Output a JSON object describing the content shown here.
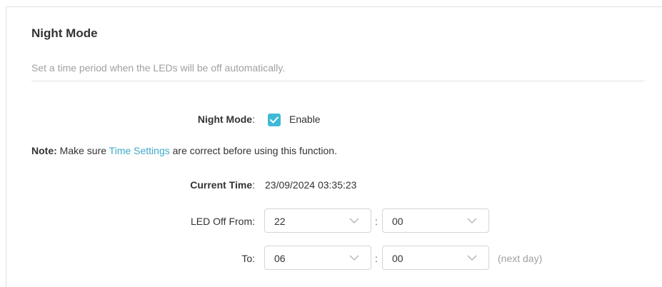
{
  "section": {
    "title": "Night Mode",
    "description": "Set a time period when the LEDs will be off automatically."
  },
  "night_mode": {
    "label": "Night Mode",
    "colon": ":",
    "checkbox_checked": true,
    "enable_label": "Enable"
  },
  "note": {
    "prefix": "Note:",
    "before": " Make sure ",
    "link": "Time Settings",
    "after": " are correct before using this function."
  },
  "current_time": {
    "label": "Current Time",
    "colon": ":",
    "value": "23/09/2024 03:35:23"
  },
  "led_off_from": {
    "label": "LED Off From:",
    "hour": "22",
    "separator": ":",
    "minute": "00"
  },
  "led_off_to": {
    "label": "To:",
    "hour": "06",
    "separator": ":",
    "minute": "00",
    "suffix": "(next day)"
  },
  "colors": {
    "accent": "#3fbad6",
    "link": "#3fa9c9",
    "muted": "#a0a0a0"
  }
}
